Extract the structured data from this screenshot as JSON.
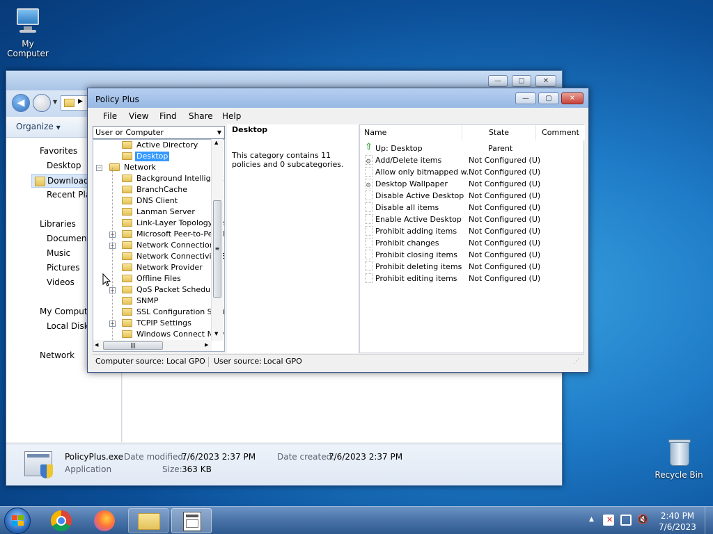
{
  "desktop": {
    "my_computer": "My Computer",
    "recycle_bin": "Recycle Bin"
  },
  "explorer": {
    "organize": "Organize",
    "nav": {
      "favorites": "Favorites",
      "desktop": "Desktop",
      "downloads": "Downloads",
      "recent_places": "Recent Plac",
      "libraries": "Libraries",
      "documents": "Document",
      "music": "Music",
      "pictures": "Pictures",
      "videos": "Videos",
      "my_computer": "My Compute",
      "local_disk": "Local Disk",
      "network": "Network"
    },
    "details": {
      "filename": "PolicyPlus.exe",
      "type": "Application",
      "date_modified_label": "Date modified:",
      "date_modified": "7/6/2023 2:37 PM",
      "date_created_label": "Date created:",
      "date_created": "7/6/2023 2:37 PM",
      "size_label": "Size:",
      "size": "363 KB"
    }
  },
  "policyplus": {
    "title": "Policy Plus",
    "menu": [
      "File",
      "View",
      "Find",
      "Share",
      "Help"
    ],
    "scope_combo": "User or Computer",
    "tree": [
      {
        "label": "Active Directory",
        "indent": 2,
        "expander": false
      },
      {
        "label": "Desktop",
        "indent": 2,
        "expander": false,
        "selected": true
      },
      {
        "label": "Network",
        "indent": 1,
        "expander": true,
        "expander_sign": "−"
      },
      {
        "label": "Background Intelligent T",
        "indent": 2,
        "expander": false
      },
      {
        "label": "BranchCache",
        "indent": 2,
        "expander": false
      },
      {
        "label": "DNS Client",
        "indent": 2,
        "expander": false
      },
      {
        "label": "Lanman Server",
        "indent": 2,
        "expander": false
      },
      {
        "label": "Link-Layer Topology Dis",
        "indent": 2,
        "expander": false
      },
      {
        "label": "Microsoft Peer-to-Peer N",
        "indent": 2,
        "expander": true,
        "expander_sign": "+"
      },
      {
        "label": "Network Connections",
        "indent": 2,
        "expander": true,
        "expander_sign": "+"
      },
      {
        "label": "Network Connectivity S",
        "indent": 2,
        "expander": false
      },
      {
        "label": "Network Provider",
        "indent": 2,
        "expander": false
      },
      {
        "label": "Offline Files",
        "indent": 2,
        "expander": false
      },
      {
        "label": "QoS Packet Scheduler",
        "indent": 2,
        "expander": true,
        "expander_sign": "+"
      },
      {
        "label": "SNMP",
        "indent": 2,
        "expander": false
      },
      {
        "label": "SSL Configuration Settir",
        "indent": 2,
        "expander": false
      },
      {
        "label": "TCPIP Settings",
        "indent": 2,
        "expander": true,
        "expander_sign": "+"
      },
      {
        "label": "Windows Connect Now",
        "indent": 2,
        "expander": false
      }
    ],
    "info": {
      "heading": "Desktop",
      "text": "This category contains 11 policies and 0 subcategories."
    },
    "list": {
      "columns": [
        "Name",
        "State",
        "Comment"
      ],
      "rows": [
        {
          "name": "Up: Desktop",
          "state": "Parent",
          "icon": "up-arrow-icon"
        },
        {
          "name": "Add/Delete items",
          "state": "Not Configured (U)",
          "icon": "gear-page-icon"
        },
        {
          "name": "Allow only bitmapped w...",
          "state": "Not Configured (U)",
          "icon": "page-icon"
        },
        {
          "name": "Desktop Wallpaper",
          "state": "Not Configured (U)",
          "icon": "gear-page-icon"
        },
        {
          "name": "Disable Active Desktop",
          "state": "Not Configured (U)",
          "icon": "page-icon"
        },
        {
          "name": "Disable all items",
          "state": "Not Configured (U)",
          "icon": "page-icon"
        },
        {
          "name": "Enable Active Desktop",
          "state": "Not Configured (U)",
          "icon": "page-icon"
        },
        {
          "name": "Prohibit adding items",
          "state": "Not Configured (U)",
          "icon": "page-icon"
        },
        {
          "name": "Prohibit changes",
          "state": "Not Configured (U)",
          "icon": "page-icon"
        },
        {
          "name": "Prohibit closing items",
          "state": "Not Configured (U)",
          "icon": "page-icon"
        },
        {
          "name": "Prohibit deleting items",
          "state": "Not Configured (U)",
          "icon": "page-icon"
        },
        {
          "name": "Prohibit editing items",
          "state": "Not Configured (U)",
          "icon": "page-icon"
        }
      ]
    },
    "status": {
      "computer_label": "Computer source:",
      "computer_value": "Local GPO",
      "user_label": "User source:",
      "user_value": "Local GPO"
    }
  },
  "taskbar": {
    "time": "2:40 PM",
    "date": "7/6/2023"
  },
  "colors": {
    "selection": "#3399ff",
    "accent_close": "#c7403a"
  }
}
